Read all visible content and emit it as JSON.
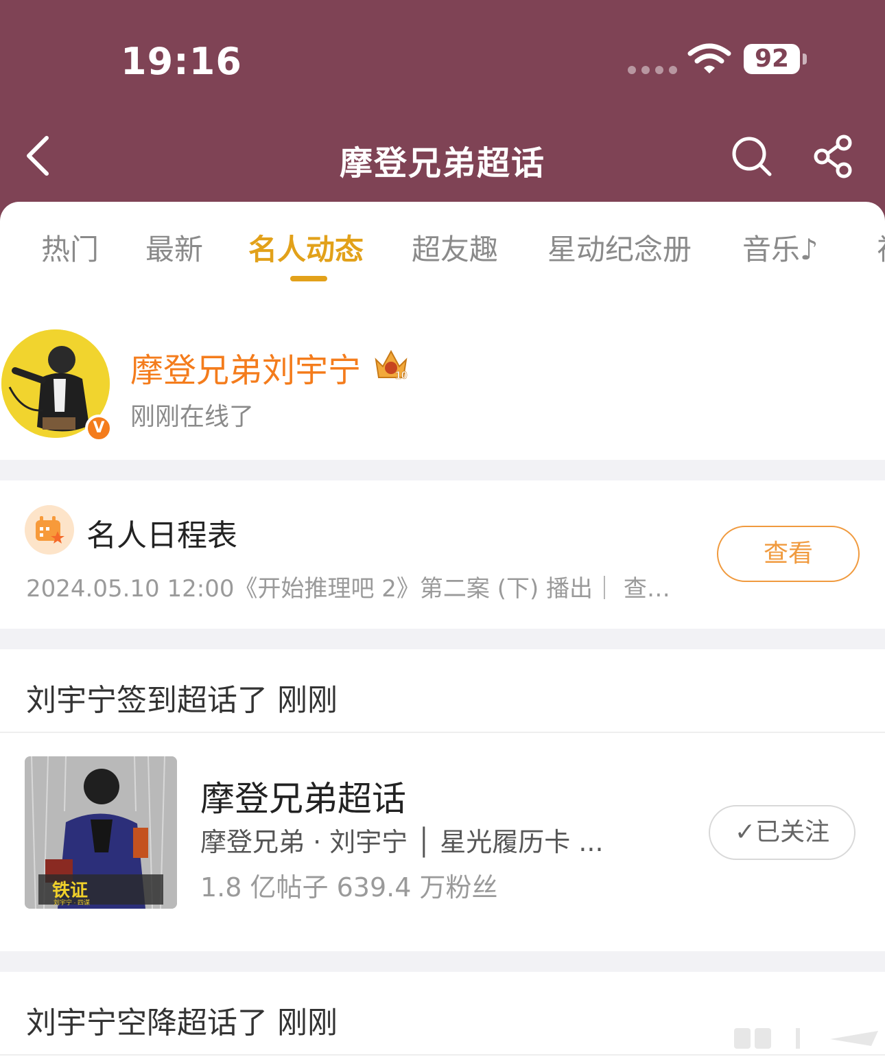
{
  "status_bar": {
    "time": "19:16",
    "battery": "92"
  },
  "nav": {
    "title": "摩登兄弟超话"
  },
  "tabs": [
    {
      "label": "热门"
    },
    {
      "label": "最新"
    },
    {
      "label": "名人动态"
    },
    {
      "label": "超友趣"
    },
    {
      "label": "星动纪念册"
    },
    {
      "label": "音乐♪"
    },
    {
      "label": "视"
    }
  ],
  "active_tab": "名人动态",
  "profile": {
    "name": "摩登兄弟刘宇宁",
    "status": "刚刚在线了",
    "crown_level": "10",
    "verified_badge": "V"
  },
  "schedule": {
    "title": "名人日程表",
    "text": "2024.05.10 12:00《开始推理吧 2》第二案 (下) 播出｜ 查看...",
    "button": "查看"
  },
  "activity1": {
    "text": "刘宇宁签到超话了 刚刚"
  },
  "topic": {
    "name": "摩登兄弟超话",
    "sub": "摩登兄弟 · 刘宇宁 │ 星光履历卡 ...",
    "stats": "1.8 亿帖子   639.4 万粉丝",
    "follow_button": "✓已关注",
    "cover_text": "铁证",
    "cover_sub": "刘宇宁 · 四谋"
  },
  "activity2": {
    "text": "刘宇宁空降超话了 刚刚"
  },
  "colors": {
    "header_bg": "#7f4355",
    "accent": "#e2a11a",
    "name": "#f47c1c"
  }
}
